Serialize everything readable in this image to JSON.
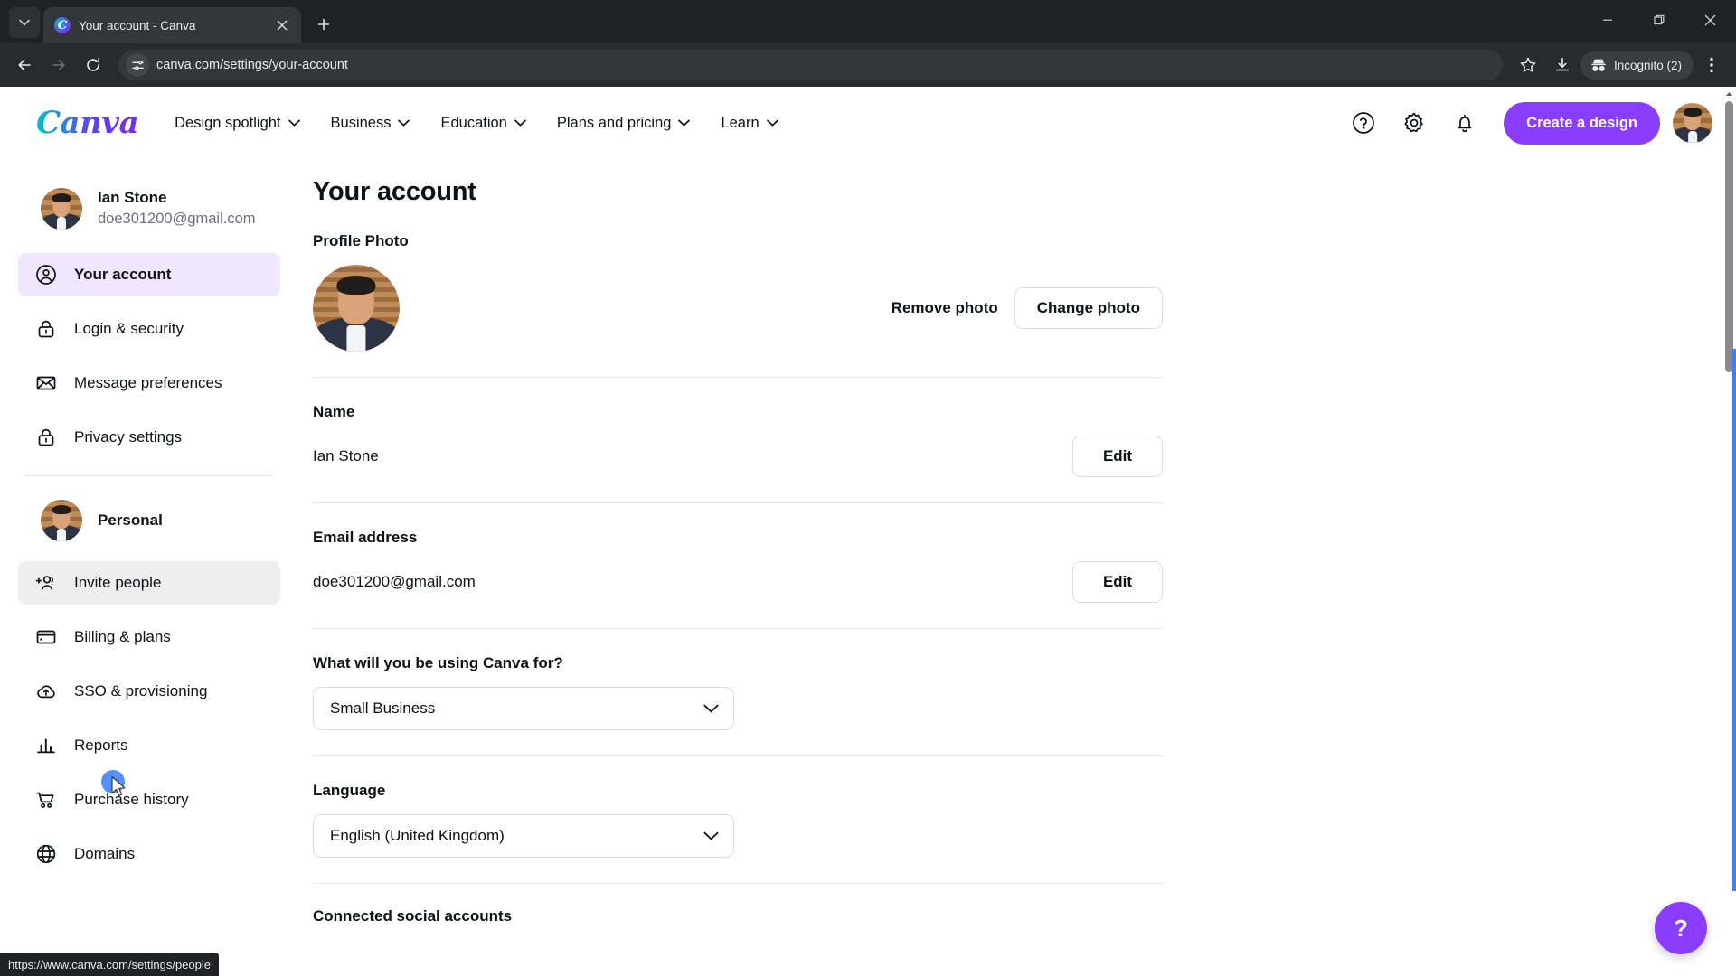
{
  "browser": {
    "tab": {
      "title": "Your account - Canva",
      "favicon": "canva-favicon"
    },
    "new_tab_label": "+",
    "url": "canva.com/settings/your-account",
    "incognito_label": "Incognito (2)",
    "status_url": "https://www.canva.com/settings/people",
    "window_controls": {
      "minimize": "minimize",
      "maximize": "restore",
      "close": "close"
    }
  },
  "header": {
    "logo": "Canva",
    "nav": [
      {
        "label": "Design spotlight"
      },
      {
        "label": "Business"
      },
      {
        "label": "Education"
      },
      {
        "label": "Plans and pricing"
      },
      {
        "label": "Learn"
      }
    ],
    "help_icon": "help-circle-icon",
    "settings_icon": "gear-icon",
    "notifications_icon": "bell-icon",
    "create_button": "Create a design",
    "accent_color": "#8b3dff"
  },
  "sidebar": {
    "account": {
      "name": "Ian Stone",
      "email": "doe301200@gmail.com"
    },
    "items": [
      {
        "label": "Your account",
        "icon": "user-circle-icon",
        "state": "active"
      },
      {
        "label": "Login & security",
        "icon": "lock-icon",
        "state": "default"
      },
      {
        "label": "Message preferences",
        "icon": "envelope-icon",
        "state": "default"
      },
      {
        "label": "Privacy settings",
        "icon": "lock-icon",
        "state": "default"
      }
    ],
    "team": {
      "name": "Personal"
    },
    "team_items": [
      {
        "label": "Invite people",
        "icon": "add-people-icon",
        "state": "hovered"
      },
      {
        "label": "Billing & plans",
        "icon": "credit-card-icon",
        "state": "default"
      },
      {
        "label": "SSO & provisioning",
        "icon": "cloud-upload-icon",
        "state": "default"
      },
      {
        "label": "Reports",
        "icon": "bar-chart-icon",
        "state": "default"
      },
      {
        "label": "Purchase history",
        "icon": "shopping-cart-icon",
        "state": "default"
      },
      {
        "label": "Domains",
        "icon": "globe-icon",
        "state": "default"
      }
    ],
    "active_bg": "#f2e6ff",
    "hover_bg": "#eeeeee"
  },
  "main": {
    "title": "Your account",
    "profile_photo": {
      "label": "Profile Photo",
      "remove_label": "Remove photo",
      "change_label": "Change photo"
    },
    "name": {
      "label": "Name",
      "value": "Ian Stone",
      "edit_label": "Edit"
    },
    "email": {
      "label": "Email address",
      "value": "doe301200@gmail.com",
      "edit_label": "Edit"
    },
    "usage": {
      "label": "What will you be using Canva for?",
      "value": "Small Business"
    },
    "language": {
      "label": "Language",
      "value": "English (United Kingdom)"
    },
    "social": {
      "label": "Connected social accounts"
    }
  },
  "help_fab": {
    "label": "?"
  }
}
